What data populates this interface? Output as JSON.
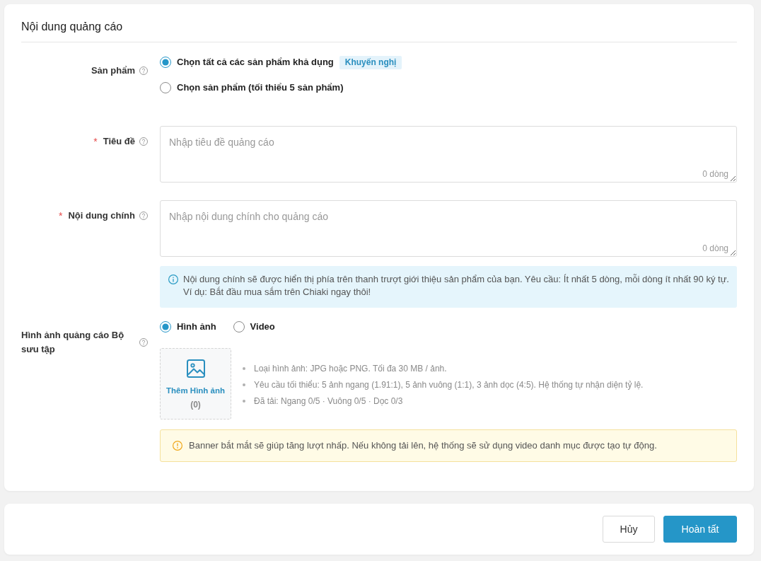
{
  "section": {
    "title": "Nội dung quảng cáo"
  },
  "fields": [
    {
      "kind": "radio_group",
      "label": "Sản phẩm",
      "options": [
        {
          "label": "Chọn tất cả các sản phẩm khả dụng",
          "badge": "Khuyến nghị",
          "selected": true
        },
        {
          "label": "Chọn sản phẩm (tối thiểu 5 sản phẩm)",
          "selected": false
        }
      ]
    },
    {
      "kind": "textarea",
      "label": "Tiêu đề",
      "required_mark": "*",
      "placeholder": "Nhập tiêu đề quảng cáo",
      "counter": "0 dòng"
    },
    {
      "kind": "textarea",
      "label": "Nội dung chính",
      "required_mark": "*",
      "placeholder": "Nhập nội dung chính cho quảng cáo",
      "counter": "0 dòng",
      "notice": {
        "kind": "info",
        "lines": [
          "Nội dung chính sẽ được hiển thị phía trên thanh trượt giới thiệu sản phẩm của bạn. Yêu cầu: Ít nhất 5 dòng, mỗi dòng ít nhất 90 ký tự.",
          "Ví dụ: Bắt đầu mua sắm trên Chiaki ngay thôi!"
        ]
      }
    },
    {
      "kind": "media",
      "label": "Hình ảnh quảng cáo Bộ sưu tập",
      "options": [
        {
          "label": "Hình ảnh",
          "selected": true
        },
        {
          "label": "Video",
          "selected": false
        }
      ],
      "upload": {
        "label": "Thêm Hình ảnh",
        "count": "(0)"
      },
      "requirements": [
        "Loại hình ảnh: JPG hoặc PNG. Tối đa 30 MB / ảnh.",
        "Yêu cầu tối thiểu: 5 ảnh ngang (1.91:1), 5 ảnh vuông (1:1), 3 ảnh dọc (4:5). Hệ thống tự nhận diện tỷ lệ.",
        "Đã tải: Ngang 0/5 · Vuông 0/5 · Dọc 0/3"
      ],
      "notice": {
        "kind": "warning",
        "lines": [
          "Banner bắt mắt sẽ giúp tăng lượt nhấp. Nếu không tải lên, hệ thống sẽ sử dụng video danh mục được tạo tự động."
        ]
      }
    }
  ],
  "actions": [
    {
      "label": "Hủy",
      "kind": "secondary"
    },
    {
      "label": "Hoàn tất",
      "kind": "primary"
    }
  ]
}
